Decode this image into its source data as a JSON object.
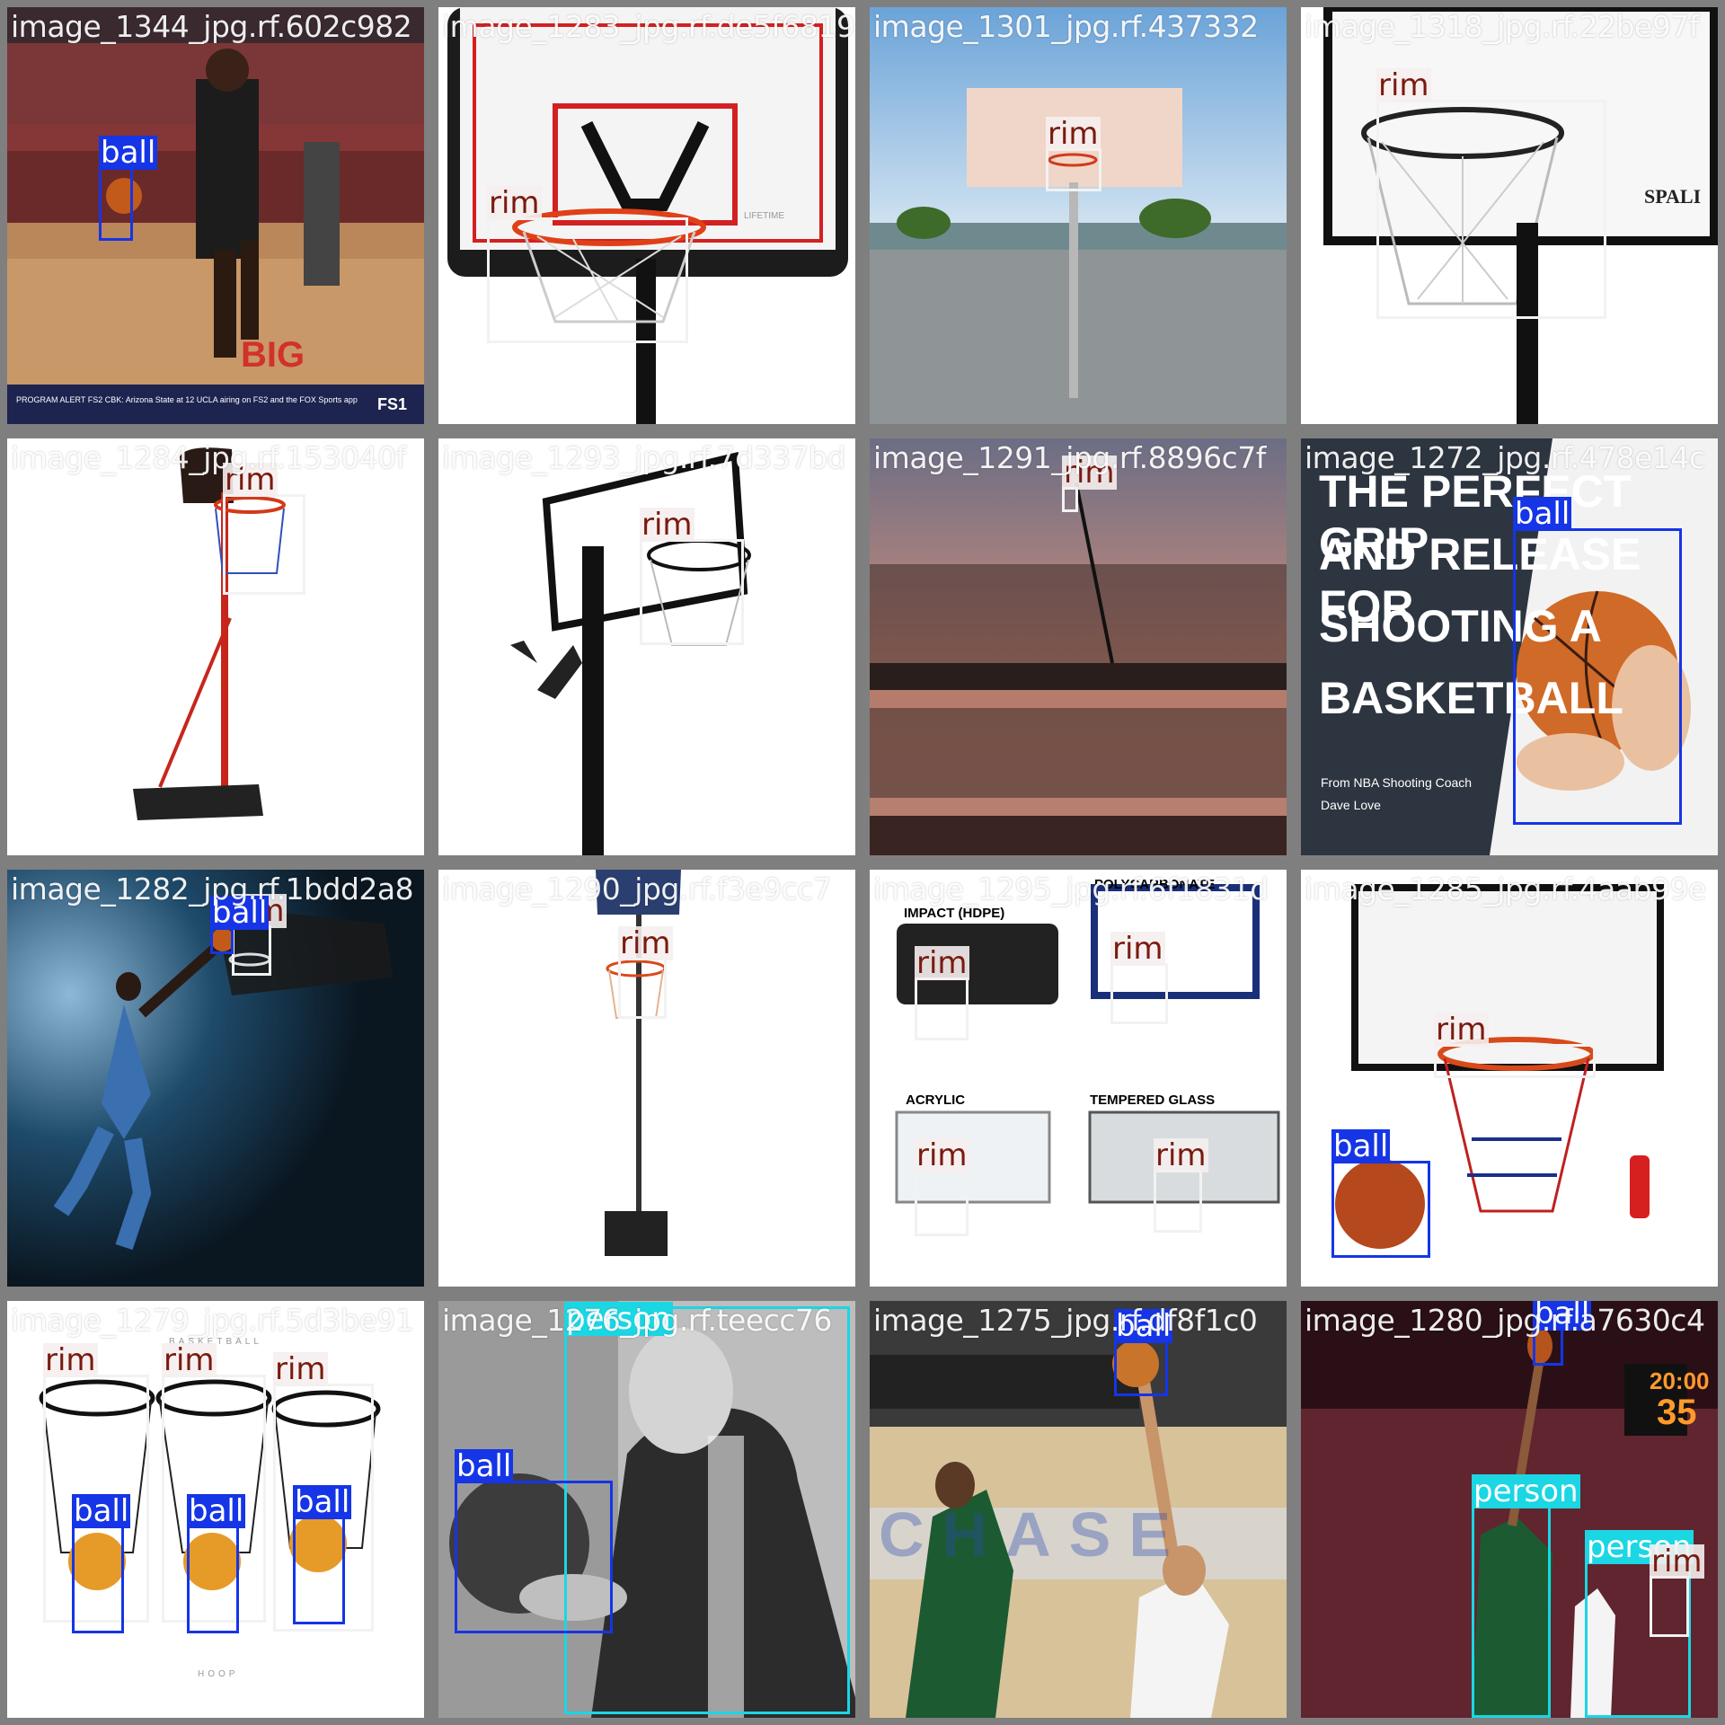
{
  "grid": {
    "tiles": [
      {
        "title": "image_1344_jpg.rf.602c982",
        "scene": "arena",
        "boxes": [
          {
            "cls": "ball",
            "label": "ball"
          }
        ]
      },
      {
        "title": "image_1283_jpg.rf.de5f6819",
        "scene": "hoop-white",
        "boxes": [
          {
            "cls": "rim",
            "label": "rim"
          }
        ]
      },
      {
        "title": "image_1301_jpg.rf.437332",
        "scene": "outdoor",
        "boxes": [
          {
            "cls": "rim",
            "label": "rim"
          }
        ]
      },
      {
        "title": "image_1318_jpg.rf.22be97f",
        "scene": "hoop-glass",
        "boxes": [
          {
            "cls": "rim",
            "label": "rim"
          }
        ]
      },
      {
        "title": "image_1284_jpg.rf.153040f",
        "scene": "portable-red",
        "boxes": [
          {
            "cls": "rim",
            "label": "rim"
          }
        ]
      },
      {
        "title": "image_1293_jpg.rf.7d337bd",
        "scene": "hoop-black",
        "boxes": [
          {
            "cls": "rim",
            "label": "rim"
          }
        ]
      },
      {
        "title": "image_1291_jpg.rf.8896c7f",
        "scene": "sunset",
        "boxes": [
          {
            "cls": "rim",
            "label": "rim"
          }
        ]
      },
      {
        "title": "image_1272_jpg.rf.478e14c",
        "scene": "poster",
        "boxes": [
          {
            "cls": "ball",
            "label": "ball"
          }
        ]
      },
      {
        "title": "image_1282_jpg.rf.1bdd2a8",
        "scene": "dunk",
        "boxes": [
          {
            "cls": "rim",
            "label": "rim"
          },
          {
            "cls": "ball",
            "label": "ball"
          }
        ]
      },
      {
        "title": "image_1290_jpg.rf.f3e9cc7",
        "scene": "portable-blue",
        "boxes": [
          {
            "cls": "rim",
            "label": "rim"
          }
        ]
      },
      {
        "title": "image_1295_jpg.rf.6f1831d",
        "scene": "four-boards",
        "boxes": [
          {
            "cls": "rim",
            "label": "rim"
          },
          {
            "cls": "rim",
            "label": "rim"
          },
          {
            "cls": "rim",
            "label": "rim"
          },
          {
            "cls": "rim",
            "label": "rim"
          }
        ]
      },
      {
        "title": "image_1285_jpg.rf.4aab99e",
        "scene": "hoop-kit",
        "boxes": [
          {
            "cls": "rim",
            "label": "rim"
          },
          {
            "cls": "ball",
            "label": "ball"
          }
        ]
      },
      {
        "title": "image_1279_jpg.rf.5d3be91",
        "scene": "three-nets",
        "boxes": [
          {
            "cls": "rim",
            "label": "rim"
          },
          {
            "cls": "rim",
            "label": "rim"
          },
          {
            "cls": "rim",
            "label": "rim"
          },
          {
            "cls": "ball",
            "label": "ball"
          },
          {
            "cls": "ball",
            "label": "ball"
          },
          {
            "cls": "ball",
            "label": "ball"
          }
        ]
      },
      {
        "title": "image_1276_jpg.rf.teecc76",
        "scene": "naismith",
        "boxes": [
          {
            "cls": "person",
            "label": "person"
          },
          {
            "cls": "ball",
            "label": "ball"
          }
        ]
      },
      {
        "title": "image_1275_jpg.rf.df8f1c0",
        "scene": "game-shot",
        "boxes": [
          {
            "cls": "ball",
            "label": "ball"
          }
        ]
      },
      {
        "title": "image_1280_jpg.rf.a7630c4",
        "scene": "game-crowd",
        "boxes": [
          {
            "cls": "ball",
            "label": "ball"
          },
          {
            "cls": "person",
            "label": "person"
          },
          {
            "cls": "person",
            "label": "person"
          },
          {
            "cls": "rim",
            "label": "rim"
          }
        ]
      }
    ]
  },
  "texts": {
    "banner": "PROGRAM ALERT   FS2   CBK: Arizona State at 12 UCLA airing on FS2 and the FOX Sports app",
    "channel": "FS1",
    "brand_lifetime": "LIFETIME",
    "brand_spalding": "SPALI",
    "poster_line1": "THE PERFECT GRIP",
    "poster_line2": "AND RELEASE FOR",
    "poster_line3": "SHOOTING A",
    "poster_line4": "BASKETBALL",
    "poster_sub1": "From NBA Shooting Coach",
    "poster_sub2": "Dave Love",
    "board1": "IMPACT (HDPE)",
    "board2": "POLYCARBONATE",
    "board3": "ACRYLIC",
    "board4": "TEMPERED GLASS",
    "basketball_caption": "BASKETBALL",
    "hoop_caption": "HOOP",
    "clock1": "20:00",
    "clock2": "35",
    "court_word": "CHASE",
    "big_word": "BIG"
  },
  "colors": {
    "rim": "#f2f2f2",
    "ball": "#1535e6",
    "person": "#1bd6e3",
    "separator": "#7f7f7f"
  }
}
